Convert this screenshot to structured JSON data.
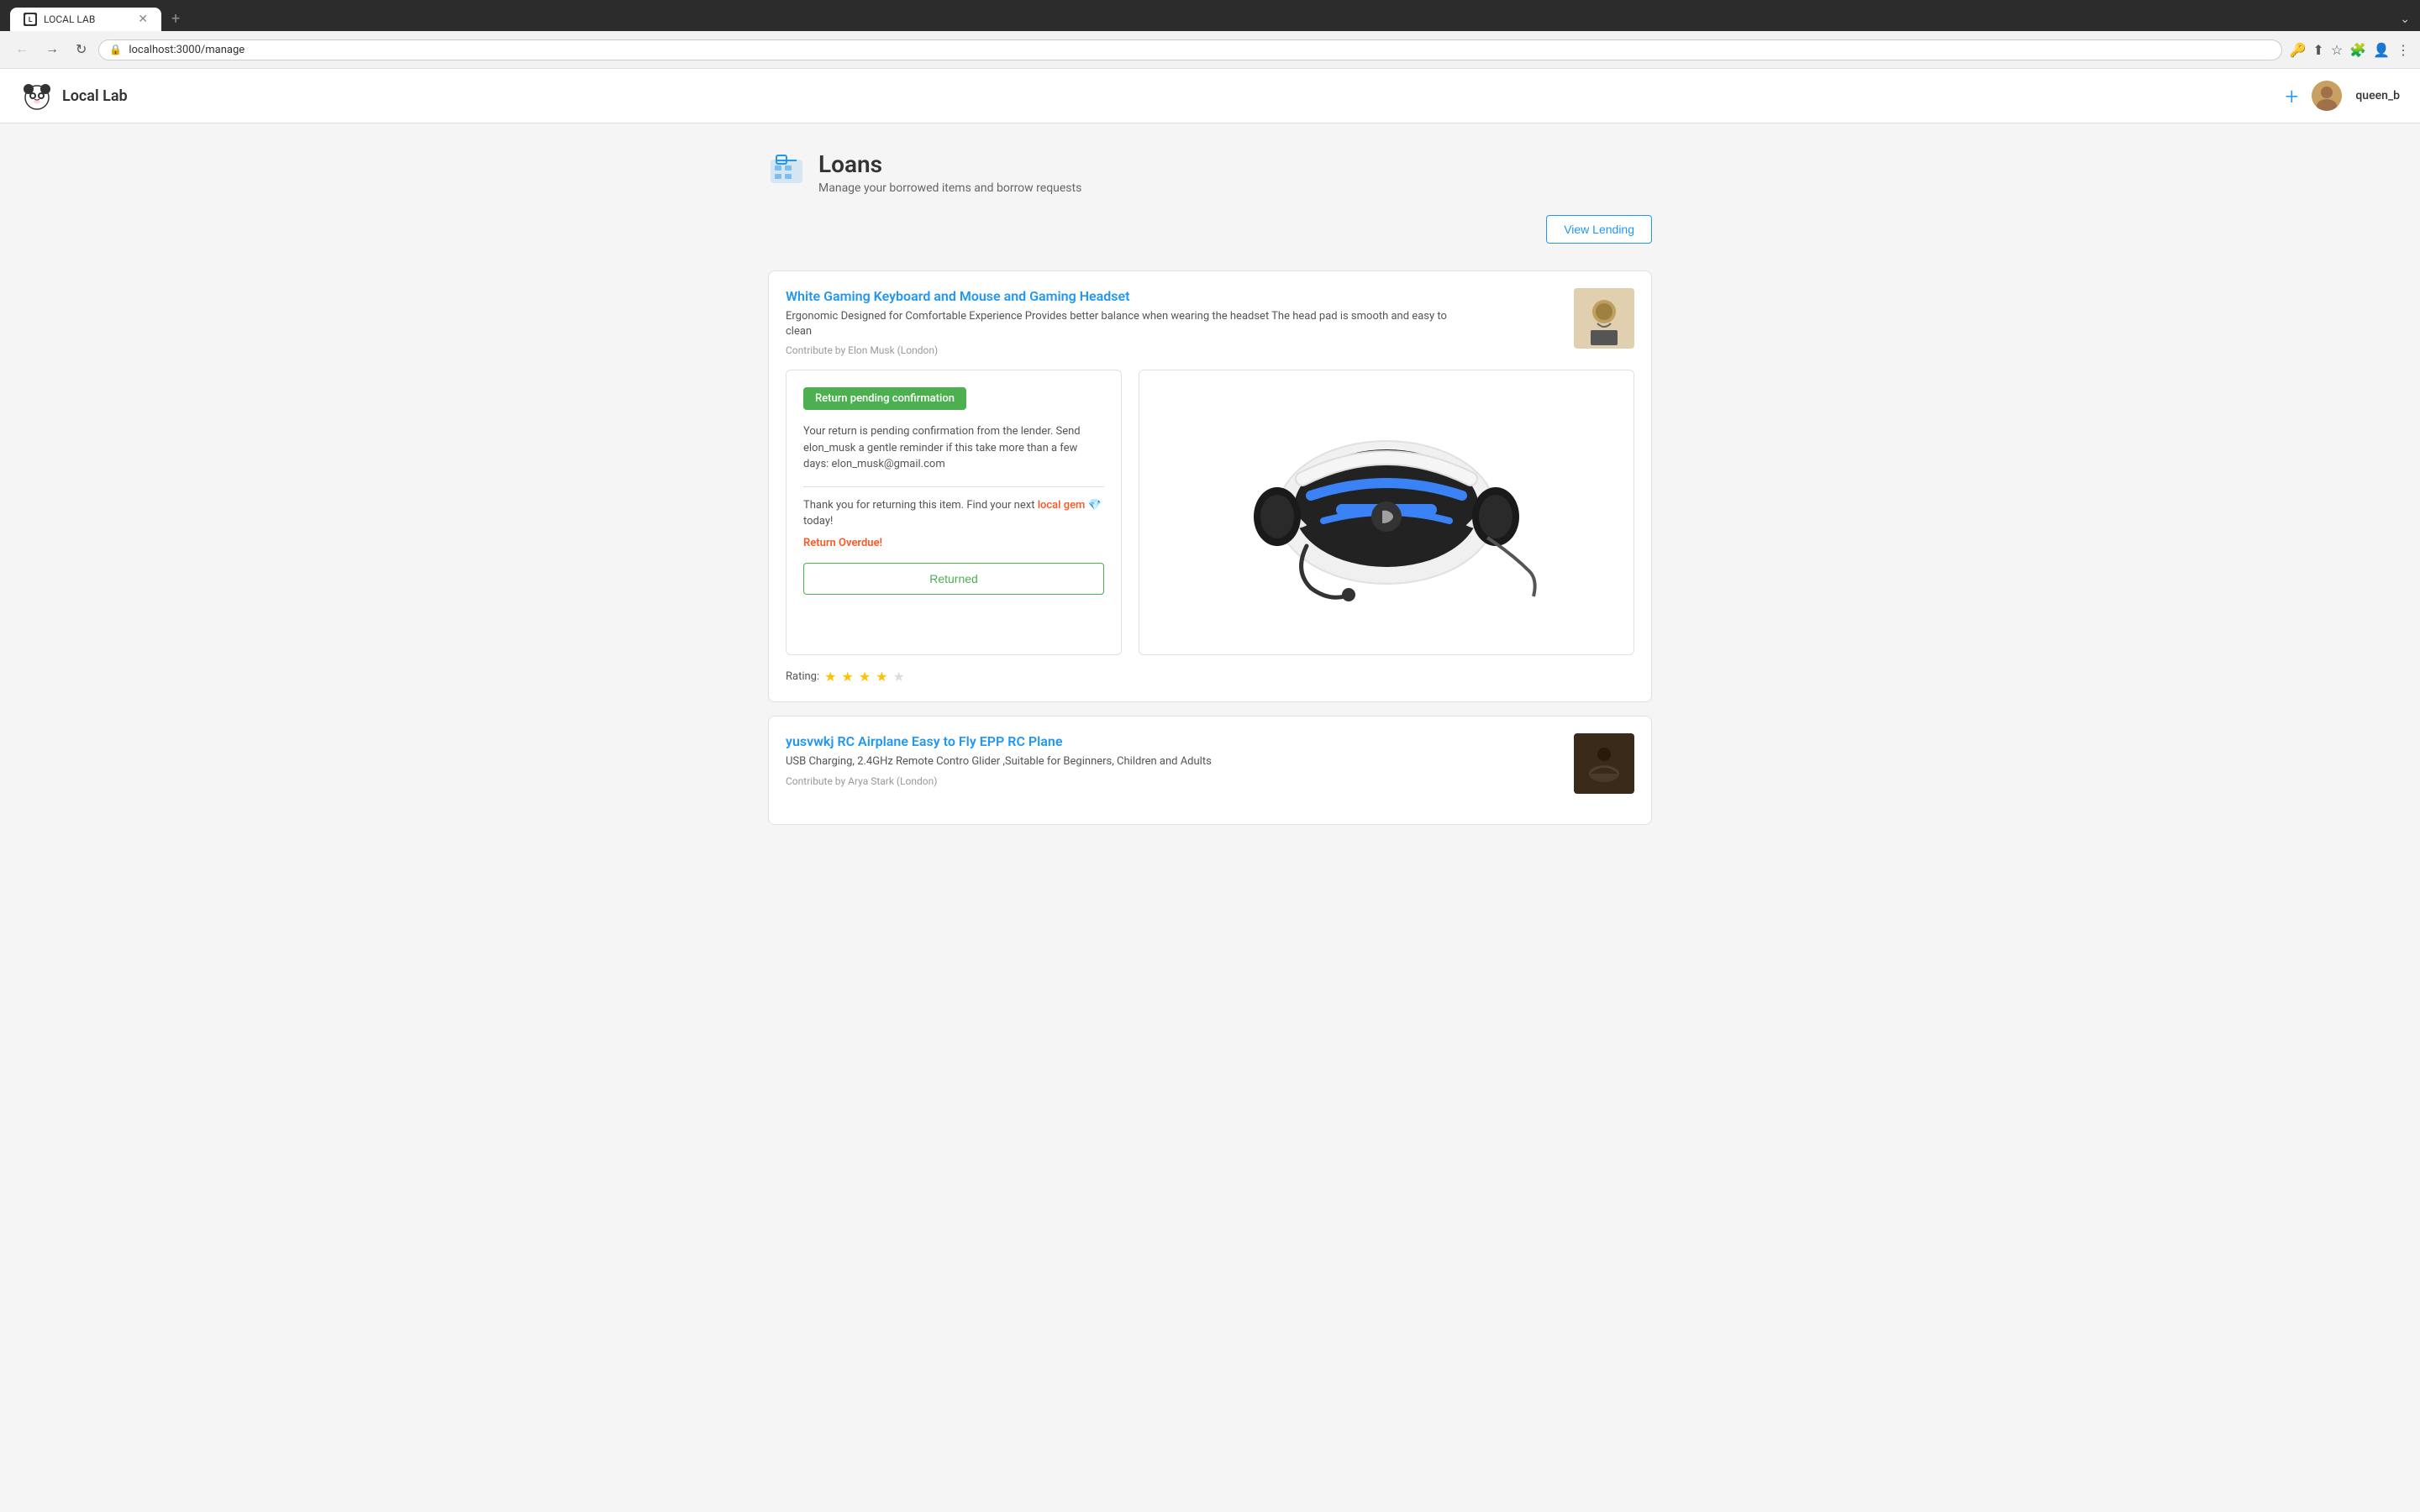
{
  "browser": {
    "tab_title": "LOCAL LAB",
    "url": "localhost:3000/manage",
    "tab_new_label": "+",
    "nav_back": "←",
    "nav_forward": "→",
    "nav_refresh": "↻"
  },
  "app": {
    "logo_text": "Local Lab",
    "add_button_label": "+",
    "username": "queen_b"
  },
  "page": {
    "title": "Loans",
    "subtitle": "Manage your borrowed items and borrow requests",
    "view_lending_label": "View Lending"
  },
  "loans": [
    {
      "title": "White Gaming Keyboard and Mouse and Gaming Headset",
      "description": "Ergonomic Designed for Comfortable Experience Provides better balance when wearing the headset The head pad is smooth and easy to clean",
      "contributor": "Contribute by Elon Musk (London)",
      "status_badge": "Return pending confirmation",
      "return_message": "Your return is pending confirmation from the lender. Send elon_musk a gentle reminder if this take more than a few days: elon_musk@gmail.com",
      "thank_you_text": "Thank you for returning this item. Find your next",
      "local_gem_link": "local gem",
      "local_gem_emoji": "💎",
      "today_text": "today!",
      "overdue_text": "Return Overdue!",
      "returned_btn_label": "Returned",
      "rating_label": "Rating:",
      "rating_filled": 4,
      "rating_total": 5
    },
    {
      "title": "yusvwkj RC Airplane Easy to Fly EPP RC Plane",
      "description": "USB Charging, 2.4GHz Remote Contro Glider ,Suitable for Beginners, Children and Adults",
      "contributor": "Contribute by Arya Stark (London)"
    }
  ]
}
